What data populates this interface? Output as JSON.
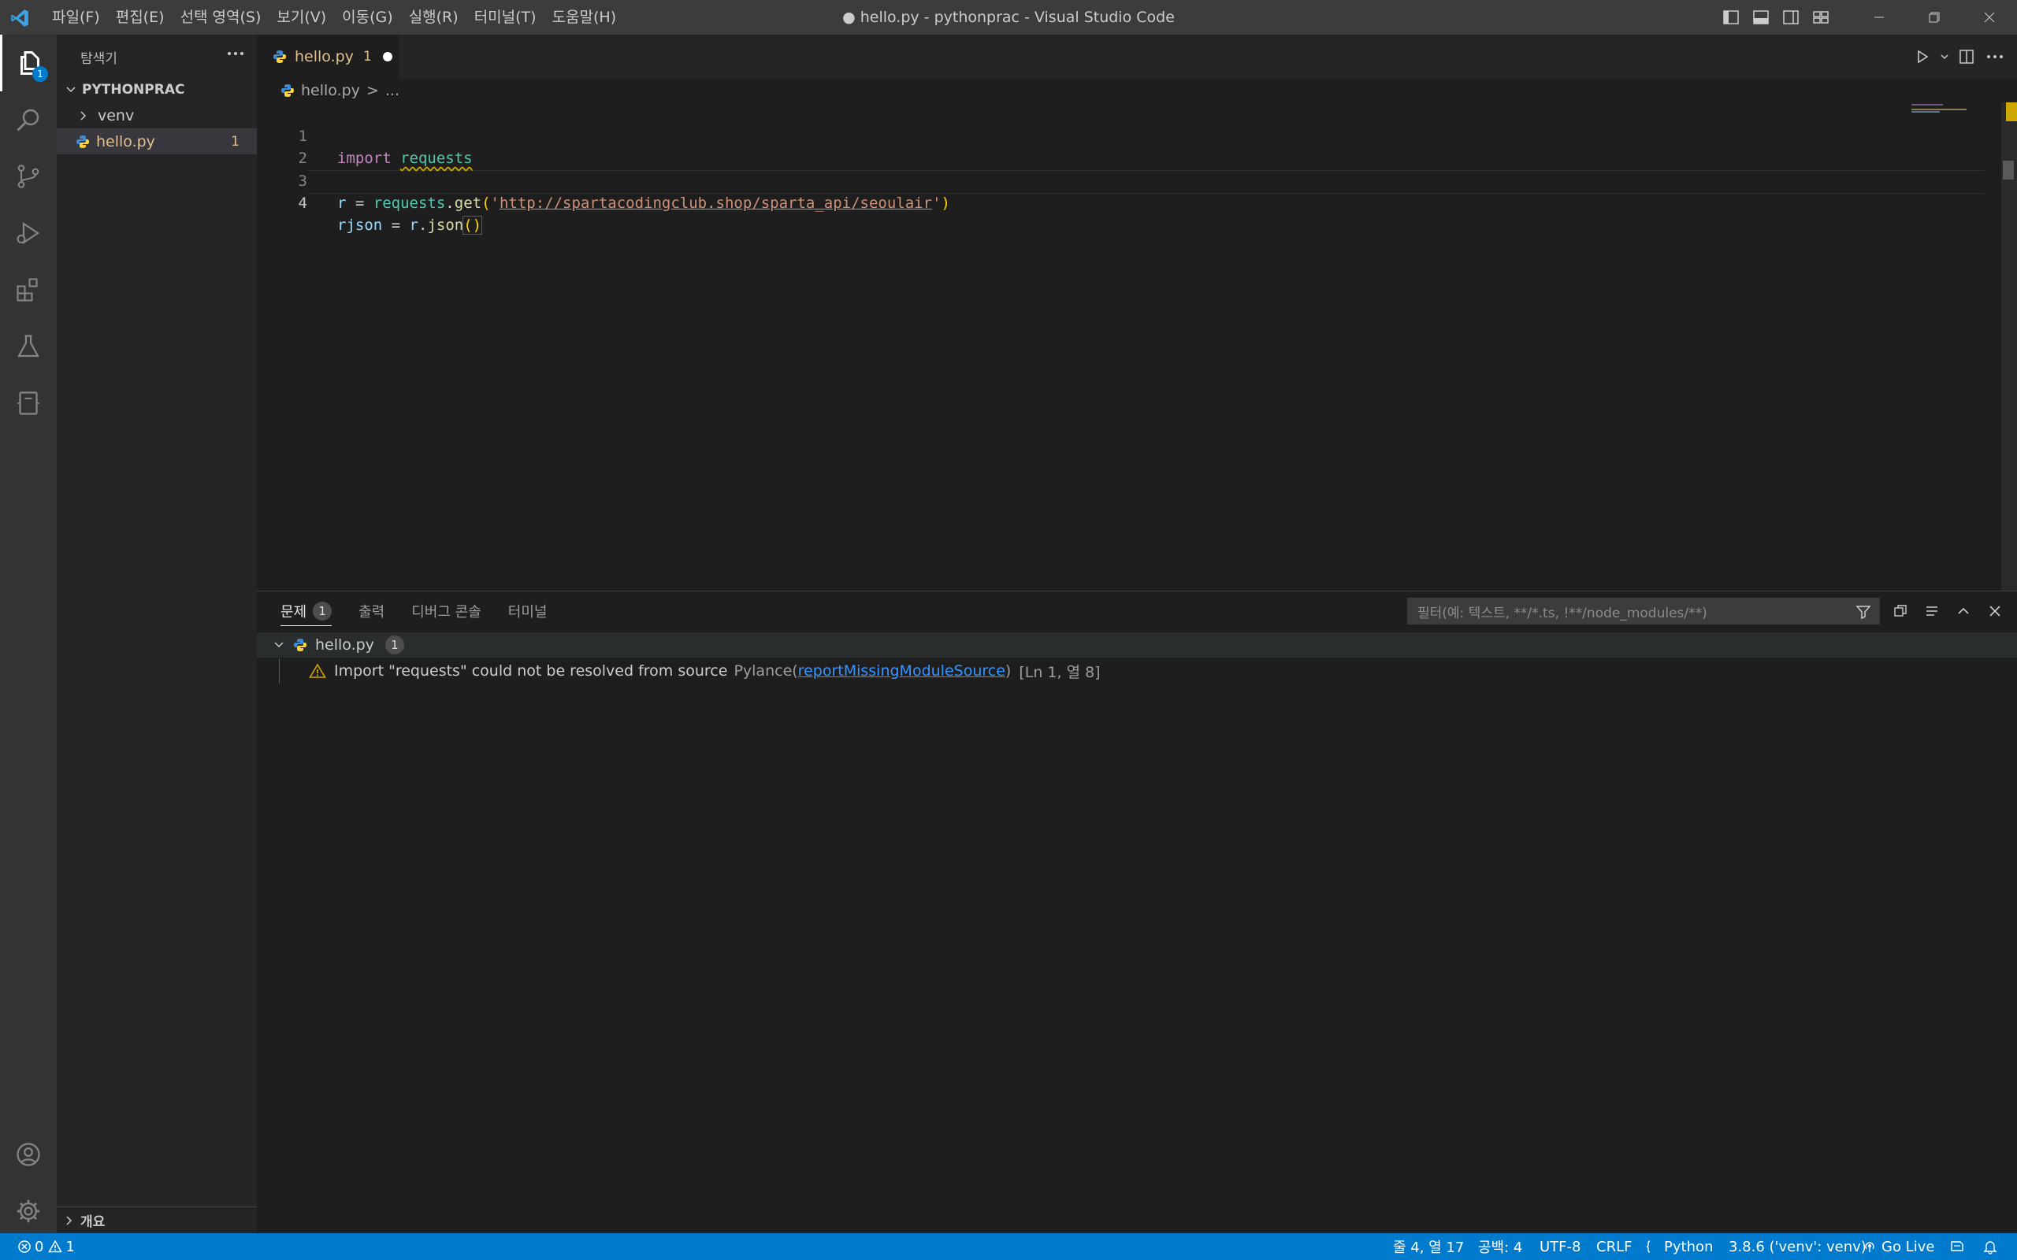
{
  "app": {
    "window_title": "● hello.py - pythonprac - Visual Studio Code"
  },
  "menu": {
    "items": [
      "파일(F)",
      "편집(E)",
      "선택 영역(S)",
      "보기(V)",
      "이동(G)",
      "실행(R)",
      "터미널(T)",
      "도움말(H)"
    ]
  },
  "activity": {
    "explorer_badge": "1"
  },
  "sidebar": {
    "title": "탐색기",
    "project": "PYTHONPRAC",
    "items": [
      {
        "label": "venv",
        "type": "folder"
      },
      {
        "label": "hello.py",
        "type": "file",
        "problems": "1"
      }
    ],
    "outline_label": "개요"
  },
  "tabs": [
    {
      "label": "hello.py",
      "problems": "1",
      "dirty": true
    }
  ],
  "breadcrumb": {
    "file": "hello.py",
    "sep": ">",
    "more": "..."
  },
  "editor": {
    "line_numbers": [
      "1",
      "2",
      "3",
      "4"
    ],
    "code": {
      "l1_kw": "import",
      "l1_mod": "requests",
      "l3_var": "r",
      "l3_eq": " = ",
      "l3_mod": "requests",
      "l3_dot": ".",
      "l3_fn": "get",
      "l3_open": "(",
      "l3_q1": "'",
      "l3_url": "http://spartacodingclub.shop/sparta_api/seoulair",
      "l3_q2": "'",
      "l3_close": ")",
      "l4_var": "rjson",
      "l4_eq": " = ",
      "l4_obj": "r",
      "l4_dot": ".",
      "l4_fn": "json",
      "l4_parens": "()"
    }
  },
  "panel": {
    "tabs": [
      {
        "label": "문제",
        "badge": "1"
      },
      {
        "label": "출력"
      },
      {
        "label": "디버그 콘솔"
      },
      {
        "label": "터미널"
      }
    ],
    "filter_placeholder": "필터(예: 텍스트, **/*.ts, !**/node_modules/**)",
    "problems": {
      "file": "hello.py",
      "count": "1",
      "message": "Import \"requests\" could not be resolved from source",
      "source": "Pylance(",
      "code": "reportMissingModuleSource",
      "source_close": ")",
      "location": "[Ln 1, 열 8]"
    }
  },
  "status": {
    "errors": "0",
    "warnings": "1",
    "position": "줄 4, 열 17",
    "spaces": "공백: 4",
    "encoding": "UTF-8",
    "eol": "CRLF",
    "language": "Python",
    "interpreter": "3.8.6 ('venv': venv)",
    "golive": "Go Live"
  },
  "colors": {
    "accent": "#007acc",
    "warning": "#cca700",
    "modified_file": "#e2c08d"
  }
}
